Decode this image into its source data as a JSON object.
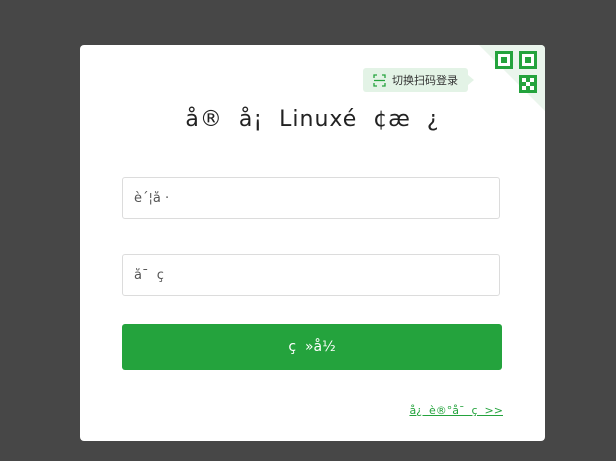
{
  "login": {
    "title": "å®  å¡  Linuxé  ¢æ  ¿",
    "qr_tip": "切换扫码登录",
    "username_placeholder": "è´¦å ·",
    "password_placeholder": "å¯  ç ",
    "login_button": "ç  »å½",
    "register_link": "å¿  è®°å¯  ç  >>"
  },
  "colors": {
    "accent": "#24a33d",
    "tip_background": "#e3f3e6",
    "page_background": "#474747"
  },
  "icons": {
    "qr": "qr-code-icon",
    "scan": "scan-icon"
  }
}
